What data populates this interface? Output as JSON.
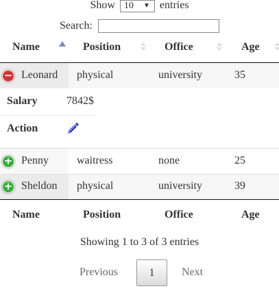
{
  "length": {
    "show": "Show",
    "value": "10",
    "arrow": "▼",
    "entries": "entries"
  },
  "filter": {
    "label": "Search:",
    "value": ""
  },
  "columns": [
    "Name",
    "Position",
    "Office",
    "Age"
  ],
  "rows": [
    {
      "name": "Leonard",
      "position": "physical",
      "office": "university",
      "age": "35",
      "expanded": true
    },
    {
      "name": "Penny",
      "position": "waitress",
      "office": "none",
      "age": "25",
      "expanded": false
    },
    {
      "name": "Sheldon",
      "position": "physical",
      "office": "university",
      "age": "39",
      "expanded": false
    }
  ],
  "child": {
    "salary_label": "Salary",
    "salary_value": "7842$",
    "action_label": "Action",
    "action_icon": "pencil-icon"
  },
  "controls": {
    "minus": "−",
    "plus": "+"
  },
  "info": "Showing 1 to 3 of 3 entries",
  "paging": {
    "previous": "Previous",
    "current": "1",
    "next": "Next"
  },
  "colors": {
    "minus": "#d33333",
    "plus": "#31b131",
    "pencil": "#1f2fd1",
    "sort_active": "#7a86c4"
  }
}
